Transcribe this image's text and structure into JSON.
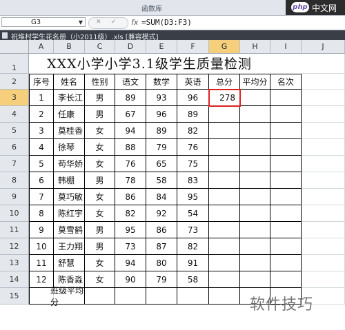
{
  "ribbon": {
    "group_label": "函数库",
    "logo_php": "php",
    "logo_cn": "中文网"
  },
  "formula_bar": {
    "name_box": "G3",
    "fx": "fx",
    "formula": "=SUM(D3:F3)",
    "cancel_icon": "✕",
    "enter_icon": "✓"
  },
  "window": {
    "title": "祝堆村学生花名册（小2011级）.xls [兼容模式]"
  },
  "columns": [
    "A",
    "B",
    "C",
    "D",
    "E",
    "F",
    "G",
    "H",
    "I",
    "J"
  ],
  "selected_column": "G",
  "selected_row": "3",
  "rows_labels": [
    "1",
    "2",
    "3",
    "4",
    "5",
    "6",
    "7",
    "8",
    "9",
    "10",
    "11",
    "12",
    "13",
    "14",
    "15"
  ],
  "sheet_title": "XXX小学小学3.1级学生质量检测",
  "headers": [
    "序号",
    "姓名",
    "性别",
    "语文",
    "数学",
    "英语",
    "总分",
    "平均分",
    "名次"
  ],
  "students": [
    {
      "no": "1",
      "name": "李长江",
      "gender": "男",
      "chinese": "89",
      "math": "93",
      "english": "96",
      "total": "278"
    },
    {
      "no": "2",
      "name": "任康",
      "gender": "男",
      "chinese": "67",
      "math": "96",
      "english": "89",
      "total": ""
    },
    {
      "no": "3",
      "name": "莫桂香",
      "gender": "女",
      "chinese": "94",
      "math": "89",
      "english": "82",
      "total": ""
    },
    {
      "no": "4",
      "name": "徐琴",
      "gender": "女",
      "chinese": "88",
      "math": "79",
      "english": "76",
      "total": ""
    },
    {
      "no": "5",
      "name": "苟华娇",
      "gender": "女",
      "chinese": "76",
      "math": "65",
      "english": "75",
      "total": ""
    },
    {
      "no": "6",
      "name": "韩棚",
      "gender": "男",
      "chinese": "78",
      "math": "58",
      "english": "83",
      "total": ""
    },
    {
      "no": "7",
      "name": "莫巧敏",
      "gender": "女",
      "chinese": "86",
      "math": "84",
      "english": "95",
      "total": ""
    },
    {
      "no": "8",
      "name": "陈红宇",
      "gender": "女",
      "chinese": "82",
      "math": "92",
      "english": "54",
      "total": ""
    },
    {
      "no": "9",
      "name": "莫雪鹤",
      "gender": "男",
      "chinese": "95",
      "math": "86",
      "english": "73",
      "total": ""
    },
    {
      "no": "10",
      "name": "王力翔",
      "gender": "男",
      "chinese": "73",
      "math": "87",
      "english": "82",
      "total": ""
    },
    {
      "no": "11",
      "name": "舒慧",
      "gender": "女",
      "chinese": "94",
      "math": "80",
      "english": "91",
      "total": ""
    },
    {
      "no": "12",
      "name": "陈香淼",
      "gender": "女",
      "chinese": "90",
      "math": "79",
      "english": "58",
      "total": ""
    }
  ],
  "class_average_label": "班级平均分",
  "watermark": "软件技巧"
}
